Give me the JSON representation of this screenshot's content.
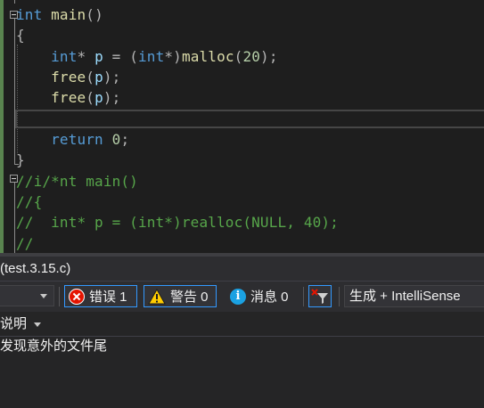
{
  "editor": {
    "lines": [
      {
        "tokens": [
          {
            "t": "int",
            "c": "kw"
          },
          {
            "t": " main",
            "c": "fn"
          },
          {
            "t": "()",
            "c": "op"
          }
        ]
      },
      {
        "tokens": [
          {
            "t": "{",
            "c": "op"
          }
        ]
      },
      {
        "tokens": [
          {
            "t": "    ",
            "c": "op"
          },
          {
            "t": "int",
            "c": "kw"
          },
          {
            "t": "*",
            "c": "op"
          },
          {
            "t": " p",
            "c": "id"
          },
          {
            "t": " = (",
            "c": "op"
          },
          {
            "t": "int",
            "c": "kw"
          },
          {
            "t": "*)",
            "c": "op"
          },
          {
            "t": "malloc",
            "c": "fn"
          },
          {
            "t": "(",
            "c": "op"
          },
          {
            "t": "20",
            "c": "num"
          },
          {
            "t": ");",
            "c": "op"
          }
        ]
      },
      {
        "tokens": [
          {
            "t": "    ",
            "c": "op"
          },
          {
            "t": "free",
            "c": "fn"
          },
          {
            "t": "(",
            "c": "op"
          },
          {
            "t": "p",
            "c": "id"
          },
          {
            "t": ");",
            "c": "op"
          }
        ]
      },
      {
        "tokens": [
          {
            "t": "    ",
            "c": "op"
          },
          {
            "t": "free",
            "c": "fn"
          },
          {
            "t": "(",
            "c": "op"
          },
          {
            "t": "p",
            "c": "id"
          },
          {
            "t": ");",
            "c": "op"
          }
        ]
      },
      {
        "tokens": []
      },
      {
        "tokens": [
          {
            "t": "    ",
            "c": "op"
          },
          {
            "t": "return",
            "c": "kw"
          },
          {
            "t": " ",
            "c": "op"
          },
          {
            "t": "0",
            "c": "num"
          },
          {
            "t": ";",
            "c": "op"
          }
        ]
      },
      {
        "tokens": [
          {
            "t": "}",
            "c": "op"
          }
        ]
      },
      {
        "tokens": [
          {
            "t": "//i/*nt main()",
            "c": "cm"
          }
        ]
      },
      {
        "tokens": [
          {
            "t": "//{",
            "c": "cm"
          }
        ]
      },
      {
        "tokens": [
          {
            "t": "//  int* p = (int*)realloc(NULL, 40);",
            "c": "cm"
          }
        ]
      },
      {
        "tokens": [
          {
            "t": "//",
            "c": "cm"
          }
        ]
      }
    ]
  },
  "panel": {
    "title": "(test.3.15.c)",
    "toolbar": {
      "errors_label": "错误 1",
      "warnings_label": "警告 0",
      "messages_label": "消息 0",
      "build_filter": "生成 + IntelliSense"
    },
    "columns": {
      "description": "说明"
    },
    "rows": [
      {
        "description": "发现意外的文件尾"
      }
    ]
  },
  "colors": {
    "editor_background": "#1e1e1e",
    "keyword": "#569cd6",
    "function": "#dcdcaa",
    "identifier": "#9cdcfe",
    "number": "#b5cea8",
    "comment": "#57a64a",
    "panel_background": "#252526",
    "error_red": "#e51400",
    "warning_yellow": "#ffcc00",
    "info_blue": "#1ba1e2",
    "focus_border": "#3399ff"
  },
  "icons": {
    "error": "error-icon",
    "warning": "warning-icon",
    "info": "info-icon",
    "filter": "clear-filter-icon",
    "fold": "collapse-icon"
  }
}
